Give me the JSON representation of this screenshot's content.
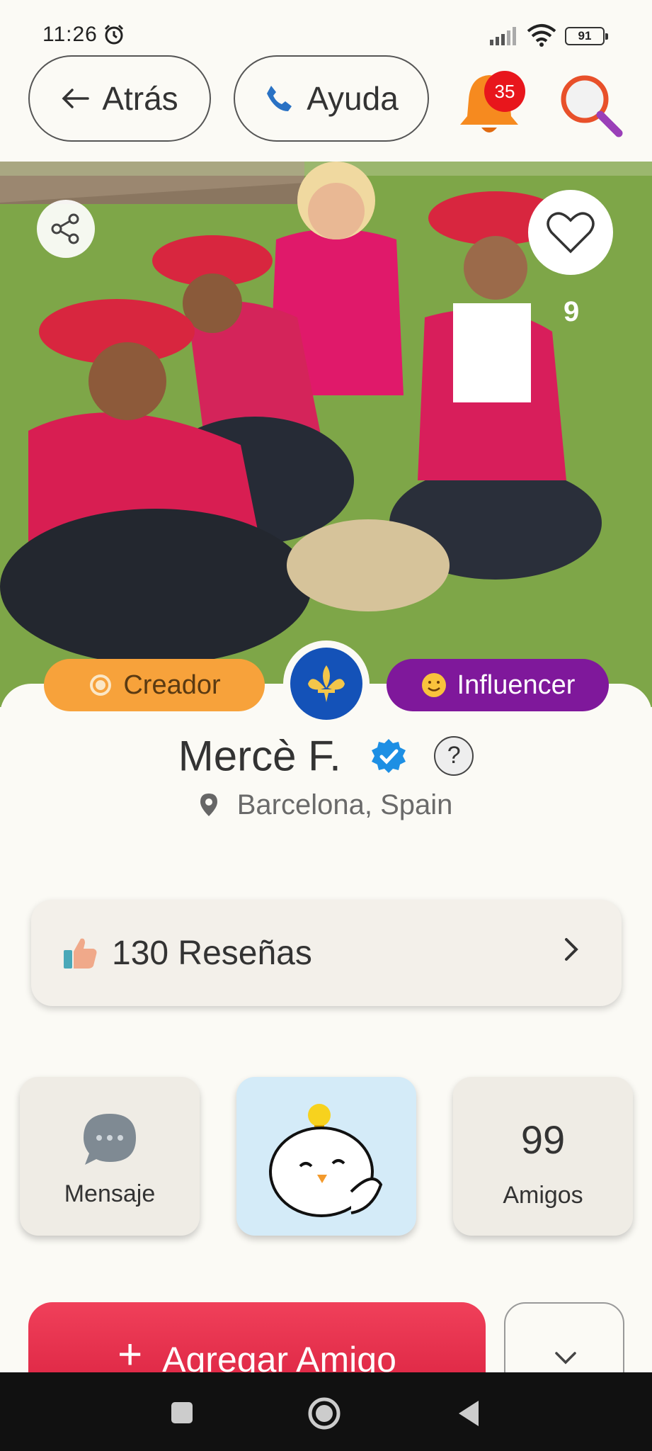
{
  "status_bar": {
    "time": "11:26",
    "battery": "91"
  },
  "header": {
    "back_label": "Atrás",
    "help_label": "Ayuda",
    "notification_count": "35"
  },
  "photo": {
    "likes": "9"
  },
  "profile": {
    "tag_creator": "Creador",
    "tag_influencer": "Influencer",
    "name": "Mercè F.",
    "help_mark": "?",
    "location": "Barcelona, Spain"
  },
  "reviews": {
    "label": "130 Reseñas"
  },
  "tiles": {
    "message_label": "Mensaje",
    "friends_count": "99",
    "friends_label": "Amigos"
  },
  "actions": {
    "add_friend_label": "Agregar Amigo"
  },
  "colors": {
    "accent_red": "#e43350",
    "creator_orange": "#f7a23b",
    "influencer_purple": "#7f189b",
    "avatar_blue": "#1452b8",
    "verified_blue": "#1d8fe4"
  }
}
